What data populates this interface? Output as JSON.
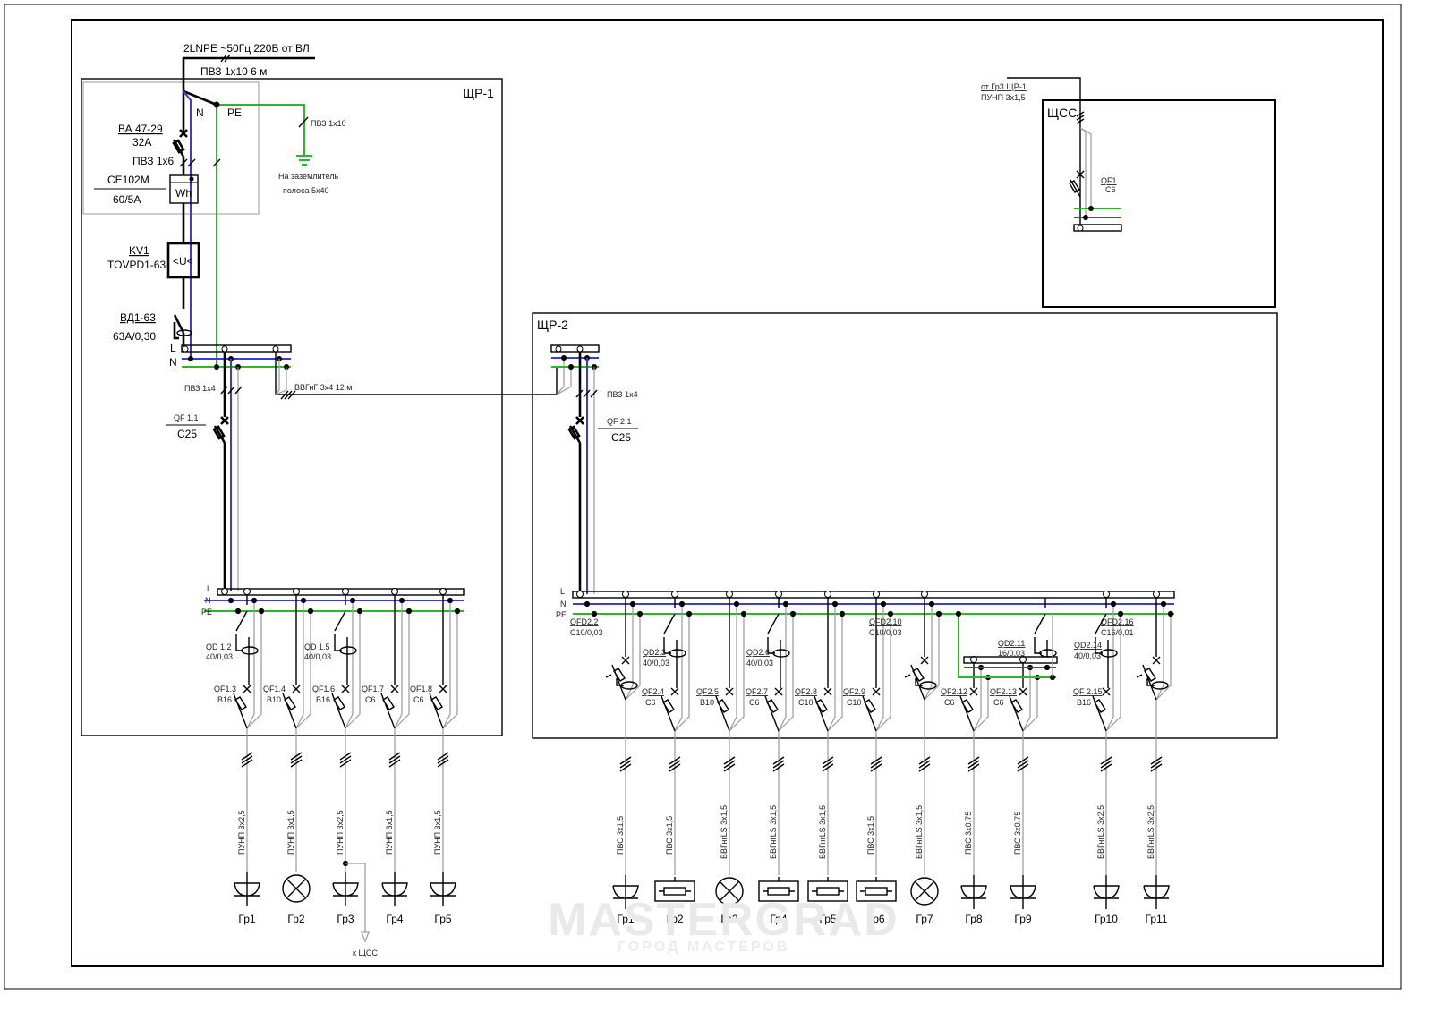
{
  "colors": {
    "phase": "#000000",
    "neutral": "#3b3bd8",
    "pe": "#2db52d",
    "aux": "#9a9a9a"
  },
  "input": {
    "supply": "2LNPE ~50Гц 220В от ВЛ",
    "supply_cable": "ПВЗ 1х10 6 м",
    "n_label": "N",
    "pe_label": "PE",
    "ground_cable": "ПВЗ 1х10",
    "ground_note1": "На заземлитель",
    "ground_note2": "полоса 5х40",
    "main_breaker": "ВА 47-29",
    "main_breaker_rating": "32А",
    "meter_cable": "ПВЗ 1х6",
    "meter": "СЕ102М",
    "meter_rating": "60/5А",
    "meter_symbol": "Wh",
    "relay": "KV1",
    "relay_model": "TOVPD1-63",
    "relay_symbol": "<U<",
    "rcd": "ВД1-63",
    "rcd_rating": "63А/0,30",
    "bus_l": "L",
    "bus_n": "N",
    "bus_pe": "PE",
    "branch_cable": "ПВЗ 1х4",
    "link_cable": "ВВГнГ 3х4 12 м"
  },
  "shr1": {
    "title": "ЩР-1",
    "input_breaker": "QF 1.1",
    "input_rating": "C25",
    "bus_l": "L",
    "bus_n": "N",
    "bus_pe": "PE",
    "to_shss": "к ЩСС",
    "rcds": [
      {
        "name": "QD 1.2",
        "rating": "40/0,03"
      },
      {
        "name": "QD 1.5",
        "rating": "40/0,03"
      }
    ],
    "feeders": [
      {
        "breaker": "QF1.3",
        "rating": "B16",
        "cable": "ПУНП 3х2,5",
        "load": "socket",
        "group": "Гр1"
      },
      {
        "breaker": "QF1.4",
        "rating": "B10",
        "cable": "ПУНП 3х1,5",
        "load": "lamp",
        "group": "Гр2"
      },
      {
        "breaker": "QF1.6",
        "rating": "B16",
        "cable": "ПУНП 3х2,5",
        "load": "socket",
        "group": "Гр3"
      },
      {
        "breaker": "QF1.7",
        "rating": "C6",
        "cable": "ПУНП 3х1,5",
        "load": "socket",
        "group": "Гр4"
      },
      {
        "breaker": "QF1.8",
        "rating": "C6",
        "cable": "ПУНП 3х1,5",
        "load": "socket",
        "group": "Гр5"
      }
    ]
  },
  "shr2": {
    "title": "ЩР-2",
    "input_cable": "ПВЗ 1х4",
    "input_breaker": "QF 2.1",
    "input_rating": "C25",
    "bus_l": "L",
    "bus_n": "N",
    "bus_pe": "PE",
    "rcds": [
      {
        "name": "QD2.3",
        "rating": "40/0,03"
      },
      {
        "name": "QD2.6",
        "rating": "40/0,03"
      },
      {
        "name": "QD2.11",
        "rating": "16/0,03"
      },
      {
        "name": "QD2.14",
        "rating": "40/0,03"
      }
    ],
    "feeders": [
      {
        "breaker": "QFD2.2",
        "rating": "C10/0,03",
        "cable": "ПВС 3х1,5",
        "load": "socket",
        "group": "Гр1"
      },
      {
        "breaker": "QF2.4",
        "rating": "C6",
        "cable": "ПВС 3х1,5",
        "load": "heater",
        "group": "Гр2"
      },
      {
        "breaker": "QF2.5",
        "rating": "B10",
        "cable": "ВВГнгLS 3х1,5",
        "load": "lamp",
        "group": "Гр3"
      },
      {
        "breaker": "QF2.7",
        "rating": "C6",
        "cable": "ВВГнгLS 3х1,5",
        "load": "heater",
        "group": "Гр4"
      },
      {
        "breaker": "QF2.8",
        "rating": "C10",
        "cable": "ВВГнгLS 3х1,5",
        "load": "heater",
        "group": "Гр5"
      },
      {
        "breaker": "QF2.9",
        "rating": "C10",
        "cable": "ПВС 3х1,5",
        "load": "heater",
        "group": "Гр6"
      },
      {
        "breaker": "QFD2.10",
        "rating": "C10/0,03",
        "cable": "ВВГнгLS 3х1,5",
        "load": "lamp",
        "group": "Гр7"
      },
      {
        "breaker": "QF2.12",
        "rating": "C6",
        "cable": "ПВС 3х0.75",
        "load": "socket",
        "group": "Гр8"
      },
      {
        "breaker": "QF2.13",
        "rating": "C6",
        "cable": "ПВС 3х0.75",
        "load": "socket",
        "group": "Гр9"
      },
      {
        "breaker": "QF 2.15",
        "rating": "B16",
        "cable": "ВВГнгLS 3х2,5",
        "load": "socket",
        "group": "Гр10"
      },
      {
        "breaker": "QFD2.16",
        "rating": "C16/0,01",
        "cable": "ВВГнгLS 3х2,5",
        "load": "socket",
        "group": "Гр11"
      }
    ]
  },
  "shss": {
    "title": "ЩСС",
    "source": "от Гр3 ЩР-1",
    "source_cable": "ПУНП 3х1,5",
    "breaker": "QF1",
    "rating": "C6"
  },
  "watermark": {
    "logo": "MASTERGRAD",
    "tagline": "ГОРОД МАСТЕРОВ"
  }
}
